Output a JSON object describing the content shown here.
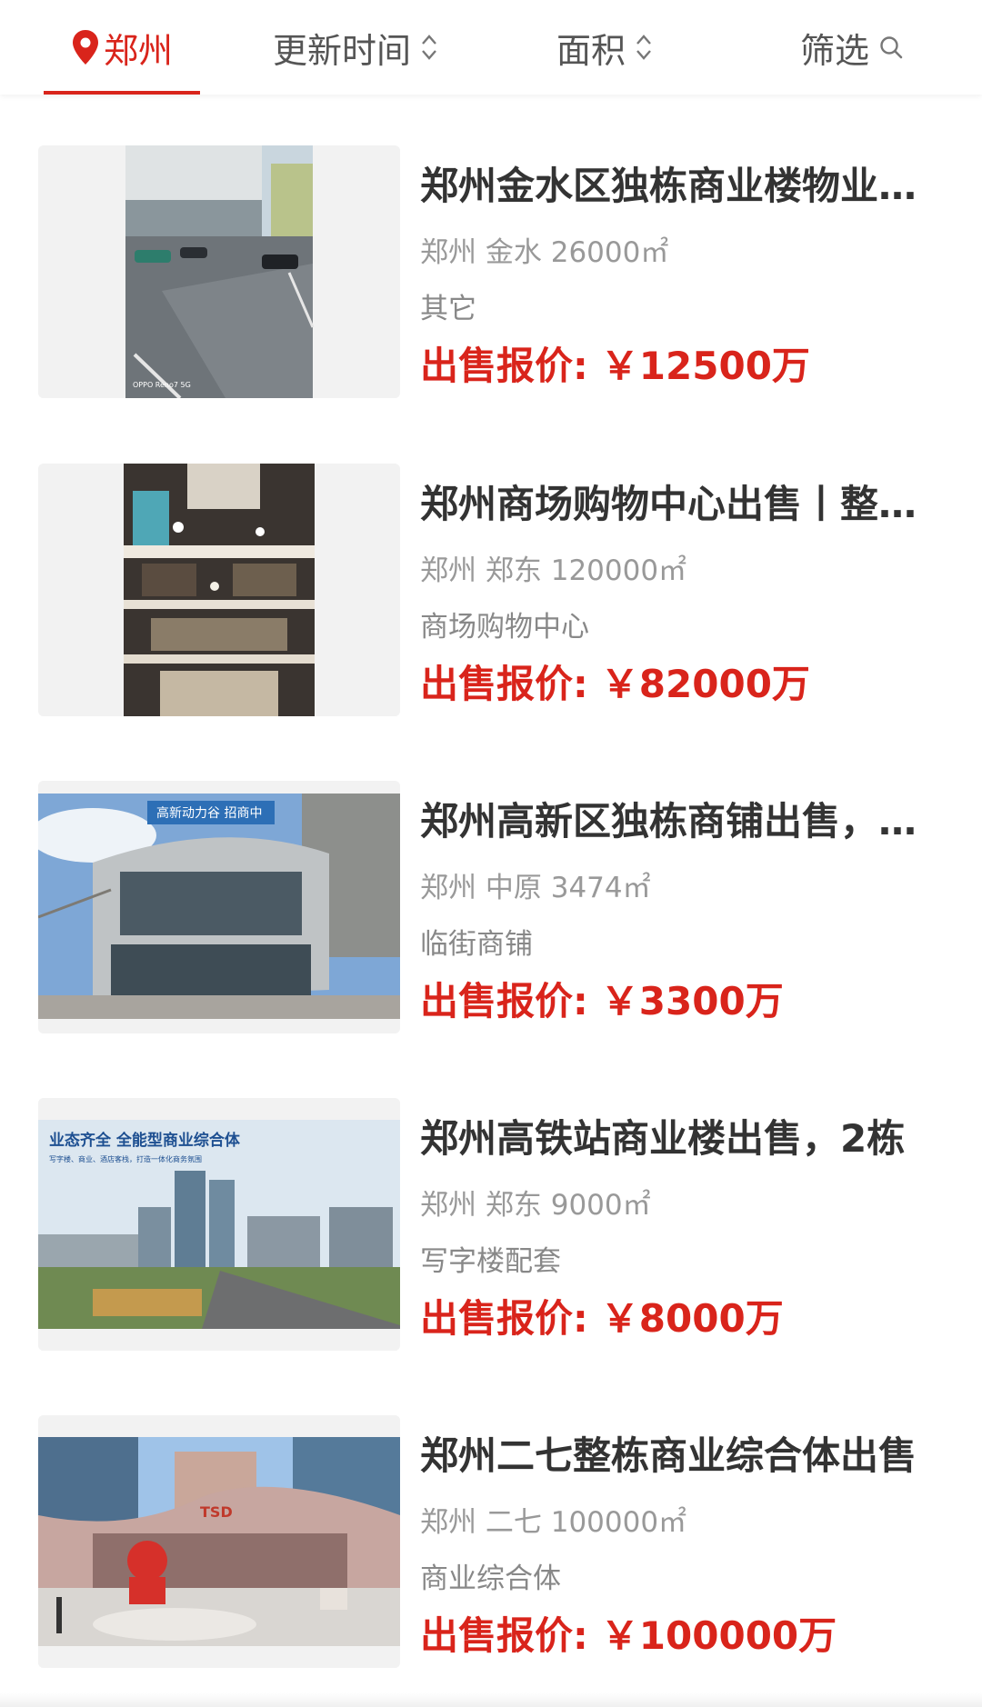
{
  "filter_bar": {
    "city": "郑州",
    "sort_update": "更新时间",
    "sort_area": "面积",
    "filter": "筛选"
  },
  "listings": [
    {
      "title": "郑州金水区独栋商业楼物业整体出售",
      "city": "郑州",
      "district": "金水",
      "area": "26000㎡",
      "category": "其它",
      "price_label": "出售报价:",
      "price": "￥12500万",
      "watermark": "OPPO Reno7 5G"
    },
    {
      "title": "郑州商场购物中心出售丨整体出售",
      "city": "郑州",
      "district": "郑东",
      "area": "120000㎡",
      "category": "商场购物中心",
      "price_label": "出售报价:",
      "price": "￥82000万"
    },
    {
      "title": "郑州高新区独栋商铺出售，临街",
      "city": "郑州",
      "district": "中原",
      "area": "3474㎡",
      "category": "临街商铺",
      "price_label": "出售报价:",
      "price": "￥3300万",
      "sign_text": "高新动力谷 招商中"
    },
    {
      "title": "郑州高铁站商业楼出售，2栋",
      "city": "郑州",
      "district": "郑东",
      "area": "9000㎡",
      "category": "写字楼配套",
      "price_label": "出售报价:",
      "price": "￥8000万",
      "banner_title": "业态齐全  全能型商业综合体",
      "banner_subtitle": "写字楼、商业、酒店客栈，打造一体化商务氛围"
    },
    {
      "title": "郑州二七整栋商业综合体出售",
      "city": "郑州",
      "district": "二七",
      "area": "100000㎡",
      "category": "商业综合体",
      "price_label": "出售报价:",
      "price": "￥100000万",
      "sign_text": "TSD"
    }
  ],
  "colors": {
    "accent": "#d9241b",
    "title": "#333333",
    "meta": "#999999"
  },
  "icons": {
    "city": "location-pin-icon",
    "sort": "sort-updown-icon",
    "filter": "search-icon"
  }
}
